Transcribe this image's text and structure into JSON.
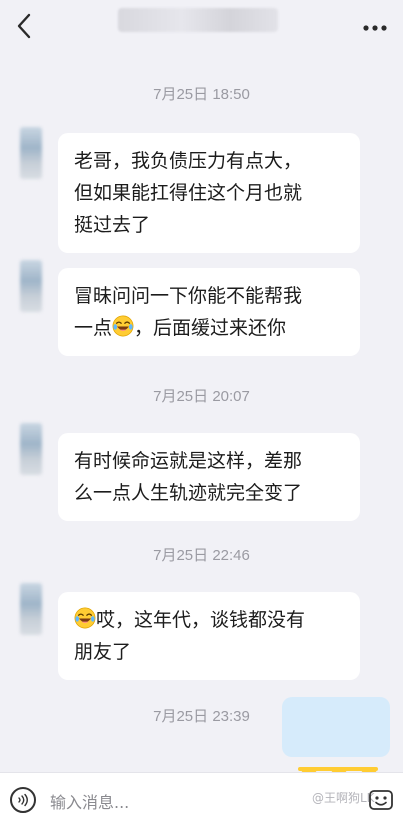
{
  "header": {
    "title": "",
    "back_icon": "chevron-left-icon",
    "more_icon": "more-dots-icon"
  },
  "messages": [
    {
      "type": "time",
      "text": "7月25日 18:50"
    },
    {
      "type": "incoming",
      "lines": [
        "老哥，我负债压力有点大，",
        "但如果能扛得住这个月也就",
        "挺过去了"
      ]
    },
    {
      "type": "incoming",
      "lines": [
        "冒昧问问一下你能不能帮我",
        "一点",
        "，后面缓过来还你"
      ],
      "emoji": "laughing-tears-emoji"
    },
    {
      "type": "time",
      "text": "7月25日 20:07"
    },
    {
      "type": "incoming",
      "lines": [
        "有时候命运就是这样，差那",
        "么一点人生轨迹就完全变了"
      ]
    },
    {
      "type": "time",
      "text": "7月25日 22:46"
    },
    {
      "type": "incoming",
      "lines": [
        "哎，这年代，谈钱都没有",
        "朋友了"
      ],
      "emoji": "laughing-tears-emoji"
    },
    {
      "type": "time",
      "text": "7月25日 23:39"
    }
  ],
  "input": {
    "placeholder": "输入消息...",
    "voice_icon": "voice-wave-icon",
    "emoji_icon": "emoji-icon"
  },
  "watermark": "@王啊狗LK",
  "colors": {
    "background": "#f1f1f6",
    "bubble_incoming": "#ffffff",
    "bubble_outgoing": "#d6ebfb",
    "timestamp": "#9a9aa2"
  }
}
